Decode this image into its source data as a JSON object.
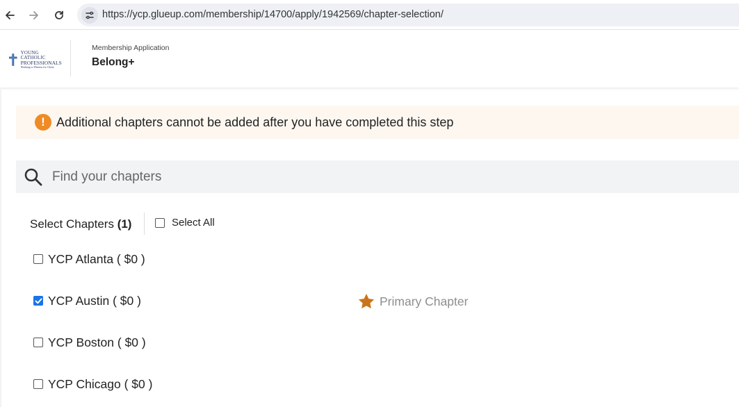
{
  "browser": {
    "url": "https://ycp.glueup.com/membership/14700/apply/1942569/chapter-selection/"
  },
  "header": {
    "logo_line1": "YOUNG CATHOLIC",
    "logo_line2": "PROFESSIONALS",
    "logo_line3": "Working to Witness for Christ",
    "subtitle": "Membership Application",
    "title": "Belong+"
  },
  "warning": {
    "text": "Additional chapters cannot be added after you have completed this step",
    "icon": "exclamation-circle-icon",
    "color": "#ee8b25"
  },
  "search": {
    "placeholder": "Find your chapters",
    "value": ""
  },
  "selection": {
    "label": "Select Chapters",
    "count": "(1)",
    "select_all_label": "Select All",
    "select_all_checked": false
  },
  "chapters": [
    {
      "label": "YCP Atlanta ( $0 )",
      "checked": false
    },
    {
      "label": "YCP Austin ( $0 )",
      "checked": true
    },
    {
      "label": "YCP Boston ( $0 )",
      "checked": false
    },
    {
      "label": "YCP Chicago ( $0 )",
      "checked": false
    }
  ],
  "primary": {
    "label": "Primary Chapter",
    "icon": "star-icon",
    "color": "#c9741a"
  },
  "colors": {
    "accent": "#1a73e8",
    "warning_bg": "#fdf7f0",
    "search_bg": "#f1f3f5"
  }
}
